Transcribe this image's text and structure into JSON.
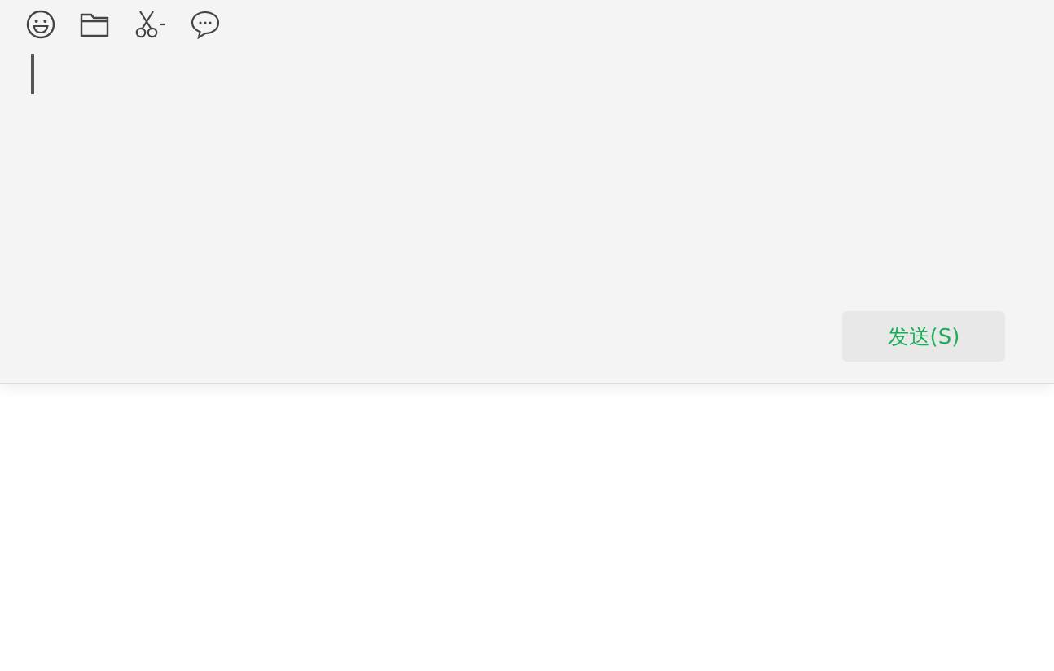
{
  "send_button": {
    "label": "发送(S)"
  }
}
